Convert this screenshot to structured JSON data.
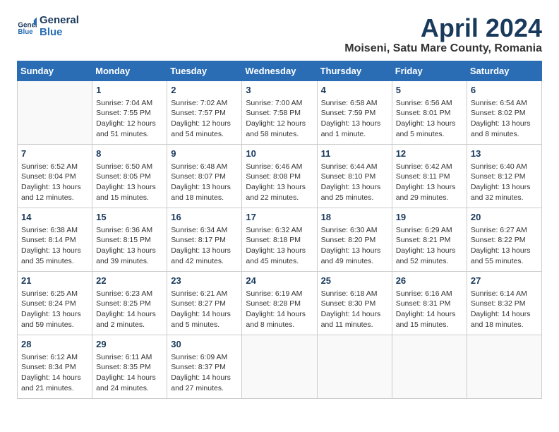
{
  "header": {
    "logo_line1": "General",
    "logo_line2": "Blue",
    "month_title": "April 2024",
    "subtitle": "Moiseni, Satu Mare County, Romania"
  },
  "days_of_week": [
    "Sunday",
    "Monday",
    "Tuesday",
    "Wednesday",
    "Thursday",
    "Friday",
    "Saturday"
  ],
  "weeks": [
    [
      {
        "day": "",
        "info": ""
      },
      {
        "day": "1",
        "info": "Sunrise: 7:04 AM\nSunset: 7:55 PM\nDaylight: 12 hours\nand 51 minutes."
      },
      {
        "day": "2",
        "info": "Sunrise: 7:02 AM\nSunset: 7:57 PM\nDaylight: 12 hours\nand 54 minutes."
      },
      {
        "day": "3",
        "info": "Sunrise: 7:00 AM\nSunset: 7:58 PM\nDaylight: 12 hours\nand 58 minutes."
      },
      {
        "day": "4",
        "info": "Sunrise: 6:58 AM\nSunset: 7:59 PM\nDaylight: 13 hours\nand 1 minute."
      },
      {
        "day": "5",
        "info": "Sunrise: 6:56 AM\nSunset: 8:01 PM\nDaylight: 13 hours\nand 5 minutes."
      },
      {
        "day": "6",
        "info": "Sunrise: 6:54 AM\nSunset: 8:02 PM\nDaylight: 13 hours\nand 8 minutes."
      }
    ],
    [
      {
        "day": "7",
        "info": "Sunrise: 6:52 AM\nSunset: 8:04 PM\nDaylight: 13 hours\nand 12 minutes."
      },
      {
        "day": "8",
        "info": "Sunrise: 6:50 AM\nSunset: 8:05 PM\nDaylight: 13 hours\nand 15 minutes."
      },
      {
        "day": "9",
        "info": "Sunrise: 6:48 AM\nSunset: 8:07 PM\nDaylight: 13 hours\nand 18 minutes."
      },
      {
        "day": "10",
        "info": "Sunrise: 6:46 AM\nSunset: 8:08 PM\nDaylight: 13 hours\nand 22 minutes."
      },
      {
        "day": "11",
        "info": "Sunrise: 6:44 AM\nSunset: 8:10 PM\nDaylight: 13 hours\nand 25 minutes."
      },
      {
        "day": "12",
        "info": "Sunrise: 6:42 AM\nSunset: 8:11 PM\nDaylight: 13 hours\nand 29 minutes."
      },
      {
        "day": "13",
        "info": "Sunrise: 6:40 AM\nSunset: 8:12 PM\nDaylight: 13 hours\nand 32 minutes."
      }
    ],
    [
      {
        "day": "14",
        "info": "Sunrise: 6:38 AM\nSunset: 8:14 PM\nDaylight: 13 hours\nand 35 minutes."
      },
      {
        "day": "15",
        "info": "Sunrise: 6:36 AM\nSunset: 8:15 PM\nDaylight: 13 hours\nand 39 minutes."
      },
      {
        "day": "16",
        "info": "Sunrise: 6:34 AM\nSunset: 8:17 PM\nDaylight: 13 hours\nand 42 minutes."
      },
      {
        "day": "17",
        "info": "Sunrise: 6:32 AM\nSunset: 8:18 PM\nDaylight: 13 hours\nand 45 minutes."
      },
      {
        "day": "18",
        "info": "Sunrise: 6:30 AM\nSunset: 8:20 PM\nDaylight: 13 hours\nand 49 minutes."
      },
      {
        "day": "19",
        "info": "Sunrise: 6:29 AM\nSunset: 8:21 PM\nDaylight: 13 hours\nand 52 minutes."
      },
      {
        "day": "20",
        "info": "Sunrise: 6:27 AM\nSunset: 8:22 PM\nDaylight: 13 hours\nand 55 minutes."
      }
    ],
    [
      {
        "day": "21",
        "info": "Sunrise: 6:25 AM\nSunset: 8:24 PM\nDaylight: 13 hours\nand 59 minutes."
      },
      {
        "day": "22",
        "info": "Sunrise: 6:23 AM\nSunset: 8:25 PM\nDaylight: 14 hours\nand 2 minutes."
      },
      {
        "day": "23",
        "info": "Sunrise: 6:21 AM\nSunset: 8:27 PM\nDaylight: 14 hours\nand 5 minutes."
      },
      {
        "day": "24",
        "info": "Sunrise: 6:19 AM\nSunset: 8:28 PM\nDaylight: 14 hours\nand 8 minutes."
      },
      {
        "day": "25",
        "info": "Sunrise: 6:18 AM\nSunset: 8:30 PM\nDaylight: 14 hours\nand 11 minutes."
      },
      {
        "day": "26",
        "info": "Sunrise: 6:16 AM\nSunset: 8:31 PM\nDaylight: 14 hours\nand 15 minutes."
      },
      {
        "day": "27",
        "info": "Sunrise: 6:14 AM\nSunset: 8:32 PM\nDaylight: 14 hours\nand 18 minutes."
      }
    ],
    [
      {
        "day": "28",
        "info": "Sunrise: 6:12 AM\nSunset: 8:34 PM\nDaylight: 14 hours\nand 21 minutes."
      },
      {
        "day": "29",
        "info": "Sunrise: 6:11 AM\nSunset: 8:35 PM\nDaylight: 14 hours\nand 24 minutes."
      },
      {
        "day": "30",
        "info": "Sunrise: 6:09 AM\nSunset: 8:37 PM\nDaylight: 14 hours\nand 27 minutes."
      },
      {
        "day": "",
        "info": ""
      },
      {
        "day": "",
        "info": ""
      },
      {
        "day": "",
        "info": ""
      },
      {
        "day": "",
        "info": ""
      }
    ]
  ]
}
